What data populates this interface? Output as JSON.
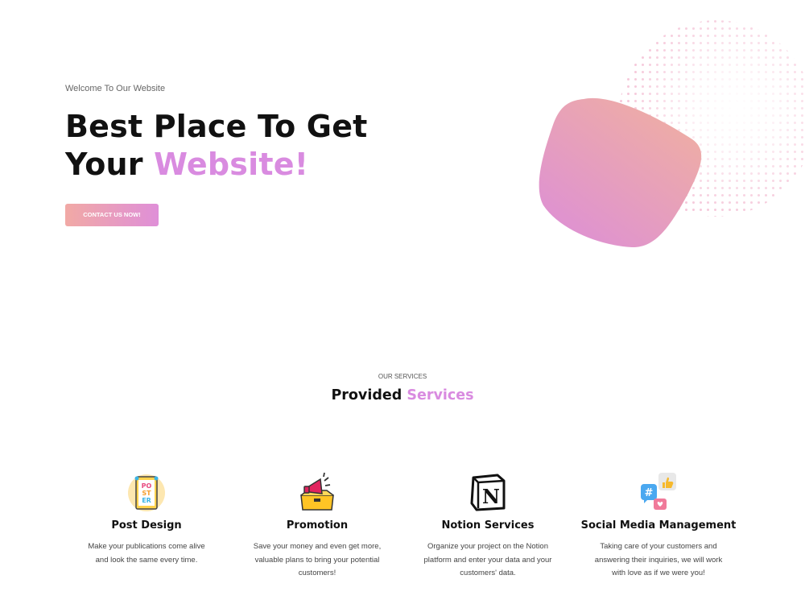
{
  "hero": {
    "kicker": "Welcome To Our Website",
    "title_line1": "Best Place To Get",
    "title_line2_prefix": "Your ",
    "title_line2_accent": "Website!",
    "cta_label": "CONTACT US NOW!"
  },
  "services": {
    "kicker": "OUR SERVICES",
    "title_prefix": "Provided ",
    "title_accent": "Services",
    "items": [
      {
        "title": "Post Design",
        "icon": "poster-icon",
        "text": "Make your publications come alive and look the same every time."
      },
      {
        "title": "Promotion",
        "icon": "megaphone-box-icon",
        "text": "Save your money and even get more, valuable plans to bring your potential customers!"
      },
      {
        "title": "Notion Services",
        "icon": "notion-logo-icon",
        "text": "Organize your project on the Notion platform and enter your data and your customers' data."
      },
      {
        "title": "Social Media Management",
        "icon": "social-media-icon",
        "text": "Taking care of your customers and answering their inquiries, we will work with love as if we were you!"
      }
    ]
  },
  "colors": {
    "accent": "#d98be0",
    "gradient_start": "#f1a9a5",
    "gradient_end": "#df8fd8",
    "dots": "#f3b8cf"
  }
}
